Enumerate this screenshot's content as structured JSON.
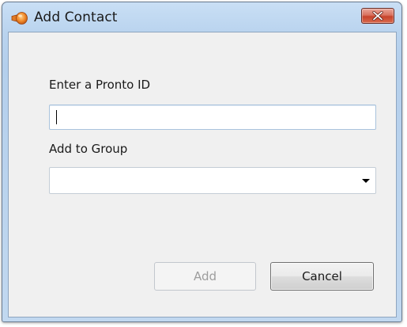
{
  "window": {
    "title": "Add Contact",
    "app_icon": "pronto-megaphone-icon",
    "close_icon": "close-icon"
  },
  "form": {
    "pronto_id_label": "Enter a Pronto ID",
    "pronto_id_value": "",
    "group_label": "Add to Group",
    "group_selected": "",
    "dropdown_icon": "chevron-down-icon"
  },
  "buttons": {
    "add_label": "Add",
    "add_enabled": false,
    "cancel_label": "Cancel"
  },
  "colors": {
    "title_bar": "#b9d3ee",
    "close_button": "#c7432b",
    "dialog_background": "#f0f0f0",
    "app_icon": "#e0781d"
  }
}
